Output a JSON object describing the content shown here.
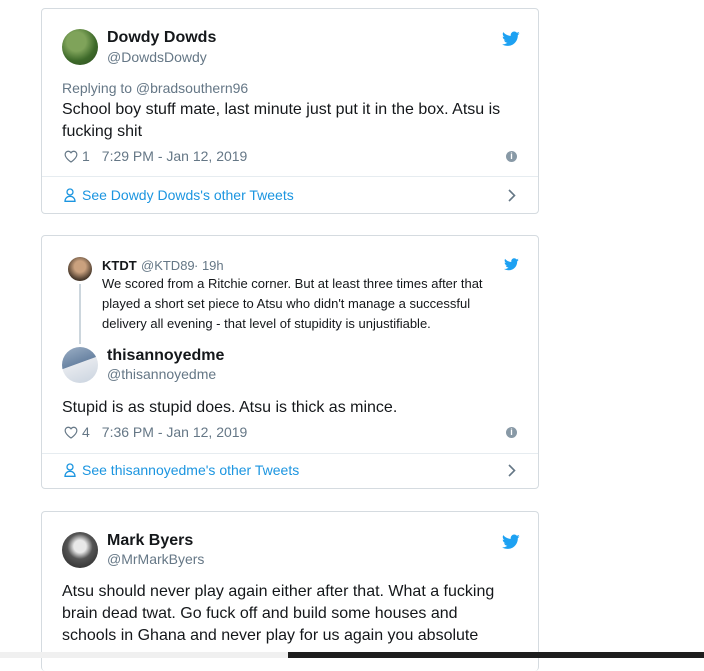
{
  "tweets": [
    {
      "name": "Dowdy Dowds",
      "handle": "@DowdsDowdy",
      "replying_to": "Replying to @bradsouthern96",
      "text_lines": [
        "School boy stuff mate, last minute just put it in the box. Atsu is",
        "fucking shit"
      ],
      "likes": "1",
      "timestamp": "7:29 PM - Jan 12, 2019",
      "other_link": "See Dowdy Dowds's other Tweets"
    },
    {
      "quoted": {
        "name": "KTDT",
        "handle": "@KTD89",
        "age": "· 19h",
        "text_lines": [
          "We scored from a Ritchie corner. But at least three times after that",
          "played a short set piece to Atsu who didn't manage a successful",
          "delivery all evening - that level of stupidity is unjustifiable."
        ]
      },
      "name": "thisannoyedme",
      "handle": "@thisannoyedme",
      "text_lines": [
        "Stupid is as stupid does. Atsu is thick as mince."
      ],
      "likes": "4",
      "timestamp": "7:36 PM - Jan 12, 2019",
      "other_link": "See thisannoyedme's other Tweets"
    },
    {
      "name": "Mark Byers",
      "handle": "@MrMarkByers",
      "text_lines": [
        "Atsu should never play again either after that.  What a fucking",
        "brain dead twat.  Go fuck off and build some houses and",
        "schools in Ghana and never play for us again you absolute"
      ]
    }
  ],
  "icons": {
    "brand": "twitter-bird-icon",
    "like": "heart-icon",
    "info": "info-icon",
    "profile": "person-icon",
    "more": "chevron-right-icon"
  },
  "colors": {
    "link": "#1b95e0",
    "twitter_blue": "#1da1f2",
    "muted": "#657786",
    "text": "#14171a",
    "border": "#d5dbe0"
  }
}
